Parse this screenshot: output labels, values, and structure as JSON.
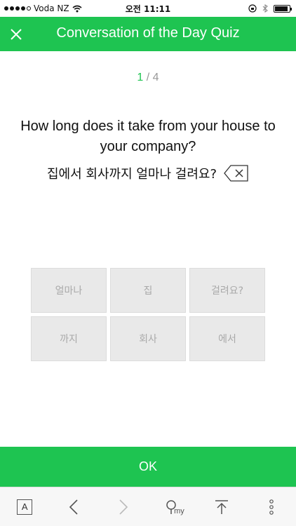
{
  "status_bar": {
    "carrier": "Voda NZ",
    "time": "오전 11:11"
  },
  "header": {
    "title": "Conversation of the Day Quiz"
  },
  "progress": {
    "current": "1",
    "separator": " / ",
    "total": "4"
  },
  "question": {
    "english": "How long does it take from your house to your company?",
    "answer": "집에서 회사까지 얼마나 걸려요?"
  },
  "word_tiles": [
    "얼마나",
    "집",
    "걸려요?",
    "까지",
    "회사",
    "에서"
  ],
  "ok_button": {
    "label": "OK"
  },
  "toolbar": {
    "font_label": "A",
    "my_label": "my"
  },
  "colors": {
    "accent": "#1ec451",
    "tile_bg": "#e9e9e9",
    "tile_text": "#a9a9a9"
  }
}
